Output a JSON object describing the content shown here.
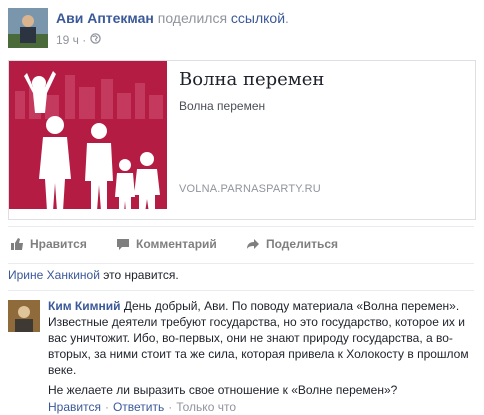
{
  "post": {
    "author": "Ави Аптекман",
    "action": "поделился",
    "object": "ссылкой",
    "object_suffix": ".",
    "time": "19 ч",
    "time_separator": "·",
    "privacy_icon": "globe-icon"
  },
  "link_card": {
    "title": "Волна перемен",
    "description": "Волна перемен",
    "domain": "VOLNA.PARNASPARTY.RU",
    "image_colors": {
      "background": "#b51c44",
      "silhouettes": "#ffffff"
    }
  },
  "actions": {
    "like": "Нравится",
    "comment": "Комментарий",
    "share": "Поделиться"
  },
  "likes": {
    "name": "Ирине Ханкиной",
    "suffix": " это нравится."
  },
  "comment": {
    "author": "Ким Кимний",
    "text": " День добрый, Ави. По поводу материала «Волна перемен». Известные деятели требуют государства, но это государство, которое их и вас уничтожит. Ибо, во-первых, они не знают природу государства, а во-вторых, за ними стоит та же сила, которая привела к Холокосту в прошлом веке.",
    "question": "Не желаете ли выразить свое отношение к «Волне перемен»?",
    "like": "Нравится",
    "reply": "Ответить",
    "separator": "·",
    "time": "Только что"
  },
  "colors": {
    "link": "#3b5998",
    "muted": "#90949c",
    "card_image_bg": "#b51c44"
  }
}
